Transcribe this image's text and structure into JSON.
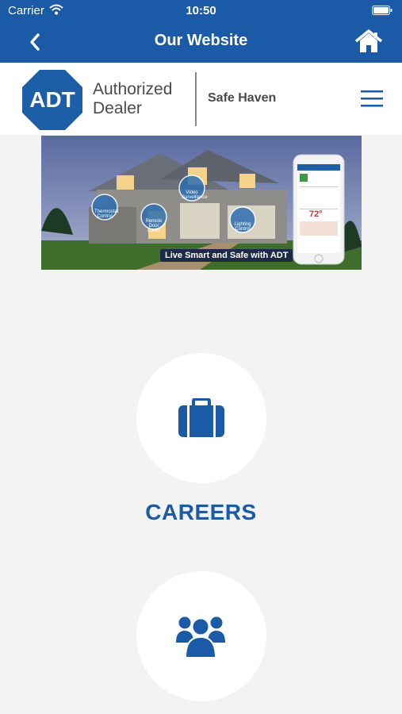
{
  "status": {
    "carrier": "Carrier",
    "time": "10:50"
  },
  "nav": {
    "title": "Our Website",
    "back_icon": "chevron-left-icon",
    "home_icon": "home-icon"
  },
  "brand": {
    "logo_text": "ADT",
    "line1": "Authorized",
    "line2": "Dealer",
    "dealer": "Safe Haven",
    "menu_icon": "hamburger-menu-icon"
  },
  "banner": {
    "caption": "Live Smart and Safe with ADT",
    "badges": [
      "Thermostat Control",
      "Remote Door Locks",
      "Video Surveillance",
      "Lighting Control"
    ],
    "phone_temp": "72°"
  },
  "sections": [
    {
      "label": "CAREERS",
      "icon": "briefcase-icon"
    },
    {
      "label": "",
      "icon": "group-icon"
    }
  ],
  "colors": {
    "primary": "#1a5aa6",
    "background": "#f3f3f3"
  }
}
